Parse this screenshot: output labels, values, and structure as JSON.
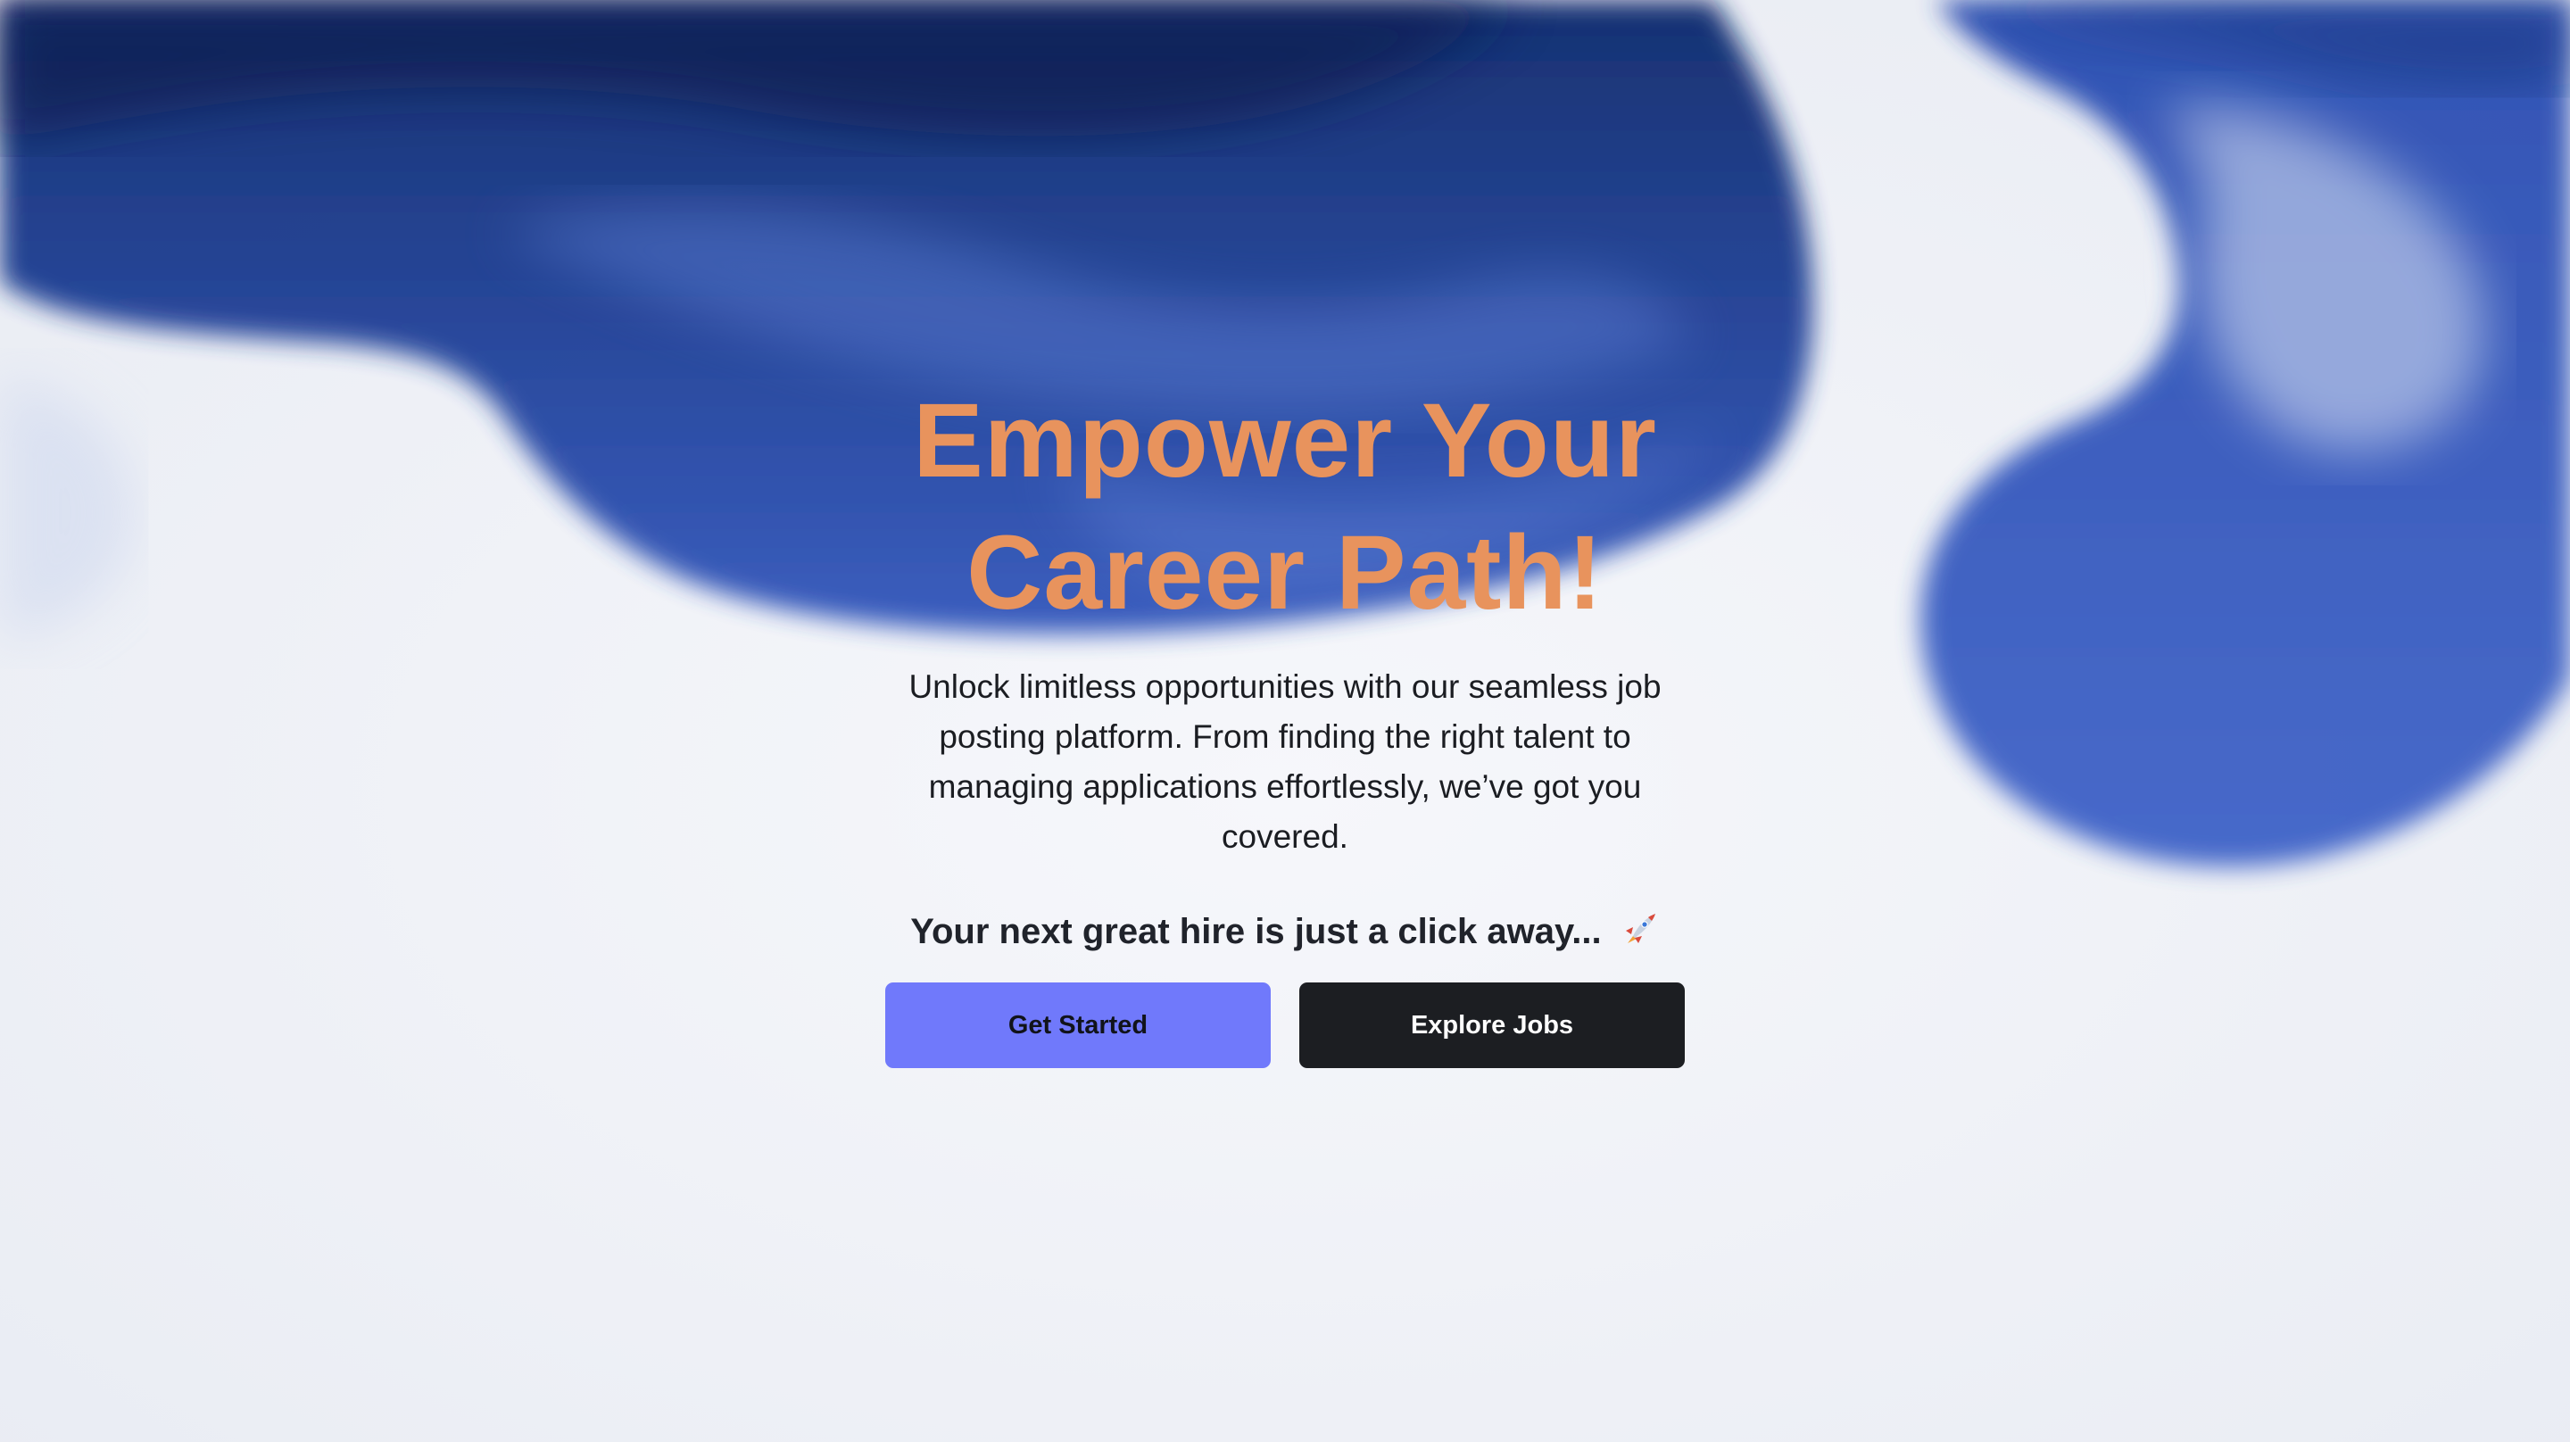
{
  "hero": {
    "headline": "Empower Your Career Path!",
    "description": "Unlock limitless opportunities with our seamless job posting platform. From finding the right talent to managing applications effortlessly, we’ve got you covered.",
    "tagline": "Your next great hire is just a click away...",
    "tagline_icon": "rocket-icon"
  },
  "actions": {
    "primary_label": "Get Started",
    "secondary_label": "Explore Jobs"
  },
  "colors": {
    "headline": "#e8935d",
    "primary_button": "#7079fb",
    "secondary_button": "#1c1e22",
    "ink_blue": "#3155b8",
    "background": "#f1f3f8"
  }
}
